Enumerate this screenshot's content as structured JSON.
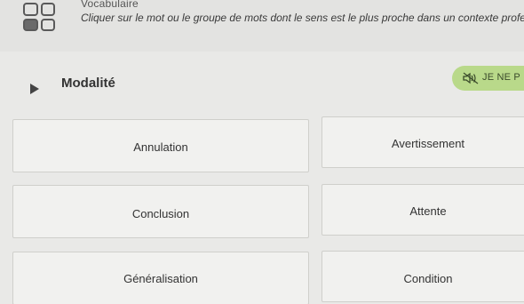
{
  "header": {
    "app_title": "Vocabulaire",
    "instruction": "Cliquer sur le mot ou le groupe de mots dont le sens est le plus proche dans un contexte profess",
    "icon": "grid-app-icon"
  },
  "question": {
    "play_icon": "play-icon",
    "word": "Modalité",
    "dont_know_label": "JE NE P",
    "dont_know_icon": "speaker-muted-icon"
  },
  "options": {
    "left": [
      "Annulation",
      "Conclusion",
      "Généralisation"
    ],
    "right": [
      "Avertissement",
      "Attente",
      "Condition"
    ]
  },
  "colors": {
    "accent_green": "#b9d98a",
    "background": "#e9e9e7",
    "option_background": "#f1f1ef"
  }
}
